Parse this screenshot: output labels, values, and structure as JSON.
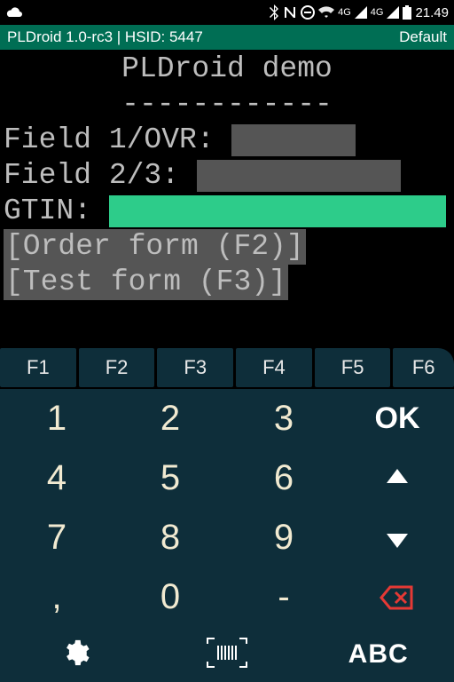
{
  "statusbar": {
    "net1_label": "4G",
    "net2_label": "4G",
    "clock": "21.49"
  },
  "titlebar": {
    "left": "PLDroid 1.0-rc3 | HSID: 5447",
    "right": "Default"
  },
  "terminal": {
    "title": "PLDroid demo",
    "divider": "------------",
    "line1_label": "Field 1/OVR:",
    "line2_label": "Field 2/3:",
    "line3_label": "GTIN:",
    "link1": "[Order form (F2)]",
    "link2": "[Test form (F3)]"
  },
  "fnkeys": [
    "F1",
    "F2",
    "F3",
    "F4",
    "F5",
    "F6"
  ],
  "keypad": {
    "rows": [
      [
        "1",
        "2",
        "3"
      ],
      [
        "4",
        "5",
        "6"
      ],
      [
        "7",
        "8",
        "9"
      ],
      [
        ",",
        "0",
        "-"
      ]
    ],
    "ok": "OK"
  },
  "bottombar": {
    "mode": "ABC"
  }
}
